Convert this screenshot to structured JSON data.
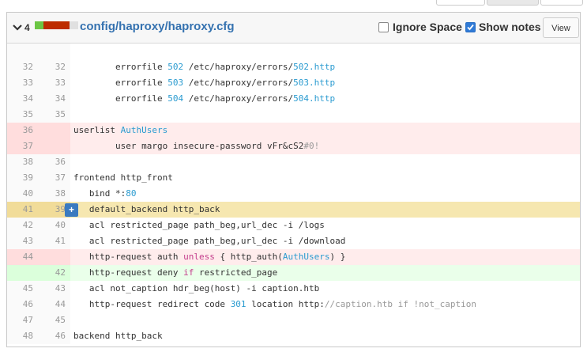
{
  "file": {
    "change_count": "4",
    "path": "config/haproxy/haproxy.cfg",
    "diffstat_colors": [
      "#6cc644",
      "#bd2c00",
      "#bd2c00",
      "#bd2c00",
      "#e0e0e0"
    ]
  },
  "controls": {
    "ignore_space_label": "Ignore Space",
    "ignore_space_checked": false,
    "show_notes_label": "Show notes",
    "show_notes_checked": true,
    "view_label": "View"
  },
  "colors": {
    "accent": "#3572b0",
    "removed_bg": "#ffecec",
    "added_bg": "#eaffea",
    "hover_bg": "#f6e7b0"
  },
  "lines": [
    {
      "old": "",
      "new": "",
      "type": "context",
      "tokens": []
    },
    {
      "old": "32",
      "new": "32",
      "type": "context",
      "tokens": [
        {
          "t": "        errorfile "
        },
        {
          "t": "502",
          "c": "num"
        },
        {
          "t": " /etc/haproxy/errors/"
        },
        {
          "t": "502",
          "c": "num"
        },
        {
          "t": ".http",
          "c": "str"
        }
      ]
    },
    {
      "old": "33",
      "new": "33",
      "type": "context",
      "tokens": [
        {
          "t": "        errorfile "
        },
        {
          "t": "503",
          "c": "num"
        },
        {
          "t": " /etc/haproxy/errors/"
        },
        {
          "t": "503",
          "c": "num"
        },
        {
          "t": ".http",
          "c": "str"
        }
      ]
    },
    {
      "old": "34",
      "new": "34",
      "type": "context",
      "tokens": [
        {
          "t": "        errorfile "
        },
        {
          "t": "504",
          "c": "num"
        },
        {
          "t": " /etc/haproxy/errors/"
        },
        {
          "t": "504",
          "c": "num"
        },
        {
          "t": ".http",
          "c": "str"
        }
      ]
    },
    {
      "old": "35",
      "new": "35",
      "type": "context",
      "tokens": []
    },
    {
      "old": "36",
      "new": "",
      "type": "removed",
      "tokens": [
        {
          "t": "userlist "
        },
        {
          "t": "AuthUsers",
          "c": "fn"
        }
      ]
    },
    {
      "old": "37",
      "new": "",
      "type": "removed",
      "tokens": [
        {
          "t": "        user margo insecure-password vFr&cS2"
        },
        {
          "t": "#0!",
          "c": "comment"
        }
      ]
    },
    {
      "old": "38",
      "new": "36",
      "type": "context",
      "tokens": []
    },
    {
      "old": "39",
      "new": "37",
      "type": "context",
      "tokens": [
        {
          "t": "frontend http_front"
        }
      ]
    },
    {
      "old": "40",
      "new": "38",
      "type": "context",
      "tokens": [
        {
          "t": "   bind *:"
        },
        {
          "t": "80",
          "c": "num"
        }
      ]
    },
    {
      "old": "41",
      "new": "39",
      "type": "hover",
      "add_comment": "+",
      "tokens": [
        {
          "t": "   default_backend http_back"
        }
      ]
    },
    {
      "old": "42",
      "new": "40",
      "type": "context",
      "tokens": [
        {
          "t": "   acl restricted_page path_beg,url_dec -i /logs"
        }
      ]
    },
    {
      "old": "43",
      "new": "41",
      "type": "context",
      "tokens": [
        {
          "t": "   acl restricted_page path_beg,url_dec -i /download"
        }
      ]
    },
    {
      "old": "44",
      "new": "",
      "type": "removed",
      "tokens": [
        {
          "t": "   http-request auth "
        },
        {
          "t": "unless",
          "c": "kw"
        },
        {
          "t": " { http_auth("
        },
        {
          "t": "AuthUsers",
          "c": "fn"
        },
        {
          "t": ") }"
        }
      ]
    },
    {
      "old": "",
      "new": "42",
      "type": "added",
      "tokens": [
        {
          "t": "   http-request deny "
        },
        {
          "t": "if",
          "c": "kw"
        },
        {
          "t": " restricted_page"
        }
      ]
    },
    {
      "old": "45",
      "new": "43",
      "type": "context",
      "tokens": [
        {
          "t": "   acl not_caption hdr_beg(host) -i caption.htb"
        }
      ]
    },
    {
      "old": "46",
      "new": "44",
      "type": "context",
      "tokens": [
        {
          "t": "   http-request redirect code "
        },
        {
          "t": "301",
          "c": "num"
        },
        {
          "t": " location http:"
        },
        {
          "t": "//caption.htb if !not_caption",
          "c": "comment"
        }
      ]
    },
    {
      "old": "47",
      "new": "45",
      "type": "context",
      "tokens": []
    },
    {
      "old": "48",
      "new": "46",
      "type": "context",
      "tokens": [
        {
          "t": "backend http_back"
        }
      ]
    }
  ]
}
